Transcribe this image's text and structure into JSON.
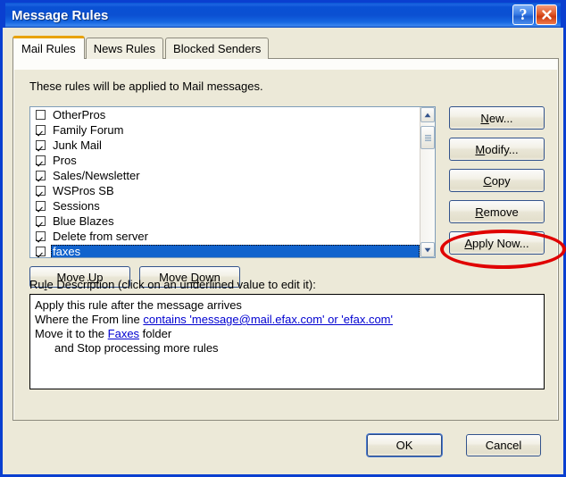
{
  "window": {
    "title": "Message Rules",
    "titlebar_color": "#0a51d4",
    "dialog_bg": "#ece9d8",
    "buttons": [
      {
        "name": "help",
        "glyph": "?"
      },
      {
        "name": "close",
        "glyph": "X"
      }
    ]
  },
  "tabs": [
    {
      "label": "Mail Rules",
      "active": true
    },
    {
      "label": "News Rules",
      "active": false
    },
    {
      "label": "Blocked Senders",
      "active": false
    }
  ],
  "panel": {
    "notice": "These rules will be applied to Mail messages."
  },
  "rules_list": {
    "items": [
      {
        "label": "OtherPros",
        "checked": false,
        "selected": false
      },
      {
        "label": "Family Forum",
        "checked": true,
        "selected": false
      },
      {
        "label": "Junk Mail",
        "checked": true,
        "selected": false
      },
      {
        "label": "Pros",
        "checked": true,
        "selected": false
      },
      {
        "label": "Sales/Newsletter",
        "checked": true,
        "selected": false
      },
      {
        "label": "WSPros SB",
        "checked": true,
        "selected": false
      },
      {
        "label": "Sessions",
        "checked": true,
        "selected": false
      },
      {
        "label": "Blue Blazes",
        "checked": true,
        "selected": false
      },
      {
        "label": "Delete from server",
        "checked": true,
        "selected": false
      },
      {
        "label": "faxes",
        "checked": true,
        "selected": true
      }
    ],
    "selection_color": "#1163cd"
  },
  "side_buttons": [
    {
      "label": "New...",
      "accel": "N"
    },
    {
      "label": "Modify...",
      "accel": "M"
    },
    {
      "label": "Copy",
      "accel": "C"
    },
    {
      "label": "Remove",
      "accel": "R"
    },
    {
      "label": "Apply Now...",
      "accel": "A"
    }
  ],
  "move_buttons": [
    {
      "label": "Move Up",
      "accel": "U"
    },
    {
      "label": "Move Down",
      "accel": "D"
    }
  ],
  "description": {
    "group_label": "Rule Description (click on an underlined value to edit it):",
    "lines": [
      {
        "prefix": "Apply this rule after the message arrives",
        "link": "",
        "suffix": "",
        "indent": false
      },
      {
        "prefix": "Where the From line ",
        "link": "contains 'message@mail.efax.com' or 'efax.com'",
        "suffix": "",
        "indent": false
      },
      {
        "prefix": "Move it to the ",
        "link": "Faxes",
        "suffix": " folder",
        "indent": false
      },
      {
        "prefix": "and Stop processing more rules",
        "link": "",
        "suffix": "",
        "indent": true
      }
    ],
    "link_color": "#0000d0"
  },
  "dialog_buttons": [
    {
      "label": "OK",
      "default": true
    },
    {
      "label": "Cancel",
      "default": false
    }
  ],
  "annotation": {
    "shape": "ellipse",
    "color": "#e00000",
    "target": "Apply Now..."
  }
}
